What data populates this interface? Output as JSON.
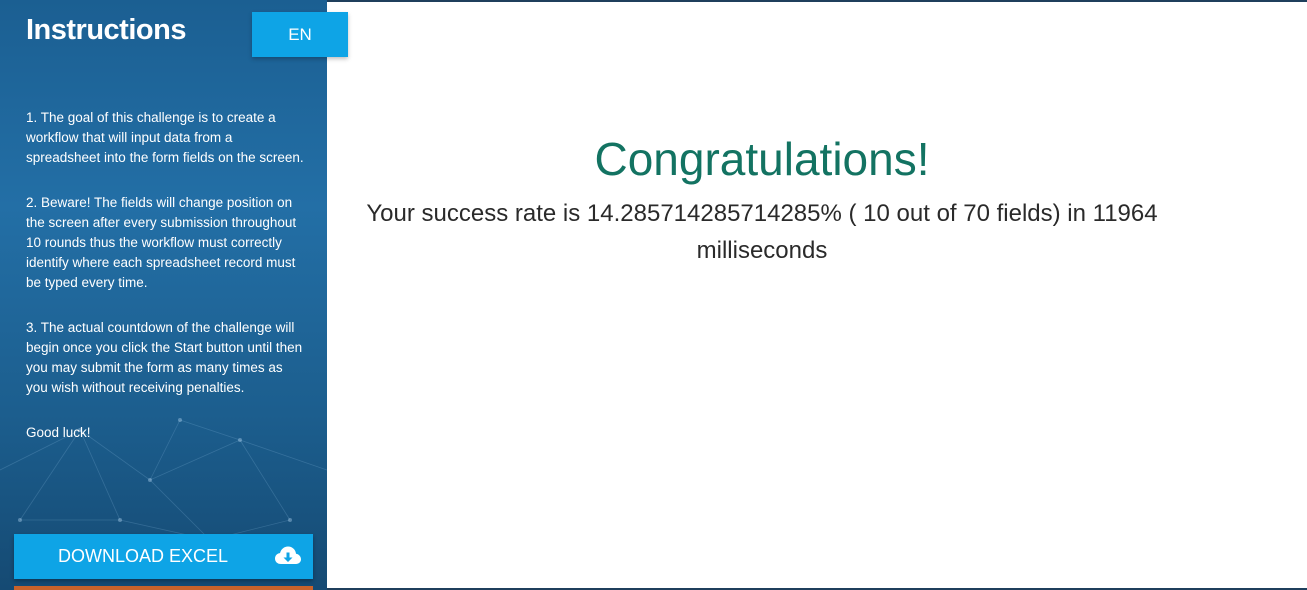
{
  "sidebar": {
    "title": "Instructions",
    "language_label": "EN",
    "instructions": [
      "1. The goal of this challenge is to create a workflow that will input data from a spreadsheet into the form fields on the screen.",
      "2. Beware! The fields will change position on the screen after every submission throughout 10 rounds thus the workflow must correctly identify where each spreadsheet record must be typed every time.",
      "3. The actual countdown of the challenge will begin once you click the Start button until then you may submit the form as many times as you wish without receiving penalties.",
      "Good luck!"
    ],
    "download_label": "DOWNLOAD EXCEL",
    "download_icon": "cloud-download-icon"
  },
  "main": {
    "heading": "Congratulations!",
    "result_text": "Your success rate is 14.285714285714285% ( 10 out of 70 fields) in 11964 milliseconds"
  },
  "colors": {
    "sidebar_bg": "#1f6aa0",
    "button_bg": "#0ea4e6",
    "heading": "#137362",
    "text": "#2a2a2a"
  }
}
